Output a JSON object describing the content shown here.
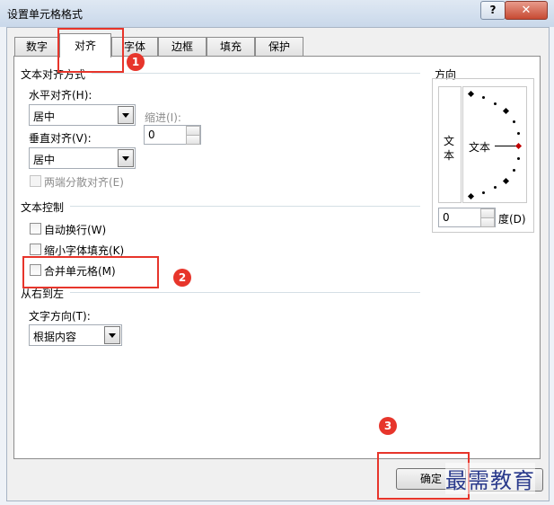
{
  "window": {
    "title": "设置单元格格式",
    "help_label": "?",
    "close_label": "✕"
  },
  "tabs": [
    "数字",
    "对齐",
    "字体",
    "边框",
    "填充",
    "保护"
  ],
  "alignment": {
    "section_title": "文本对齐方式",
    "horizontal_label": "水平对齐(H):",
    "horizontal_value": "居中",
    "indent_label": "缩进(I):",
    "indent_value": "0",
    "vertical_label": "垂直对齐(V):",
    "vertical_value": "居中",
    "justify_distributed_label": "两端分散对齐(E)"
  },
  "text_control": {
    "section_title": "文本控制",
    "wrap_text_label": "自动换行(W)",
    "shrink_label": "缩小字体填充(K)",
    "merge_label": "合并单元格(M)"
  },
  "rtl": {
    "section_title": "从右到左",
    "direction_label": "文字方向(T):",
    "direction_value": "根据内容"
  },
  "orientation": {
    "section_title": "方向",
    "vertical_text": "文本",
    "horizontal_text": "文本",
    "degrees_value": "0",
    "degrees_label": "度(D)"
  },
  "footer": {
    "ok_label": "确定"
  },
  "annotations": {
    "badge1": "1",
    "badge2": "2",
    "badge3": "3",
    "accent": "#e7352b"
  },
  "watermark": "最需教育"
}
